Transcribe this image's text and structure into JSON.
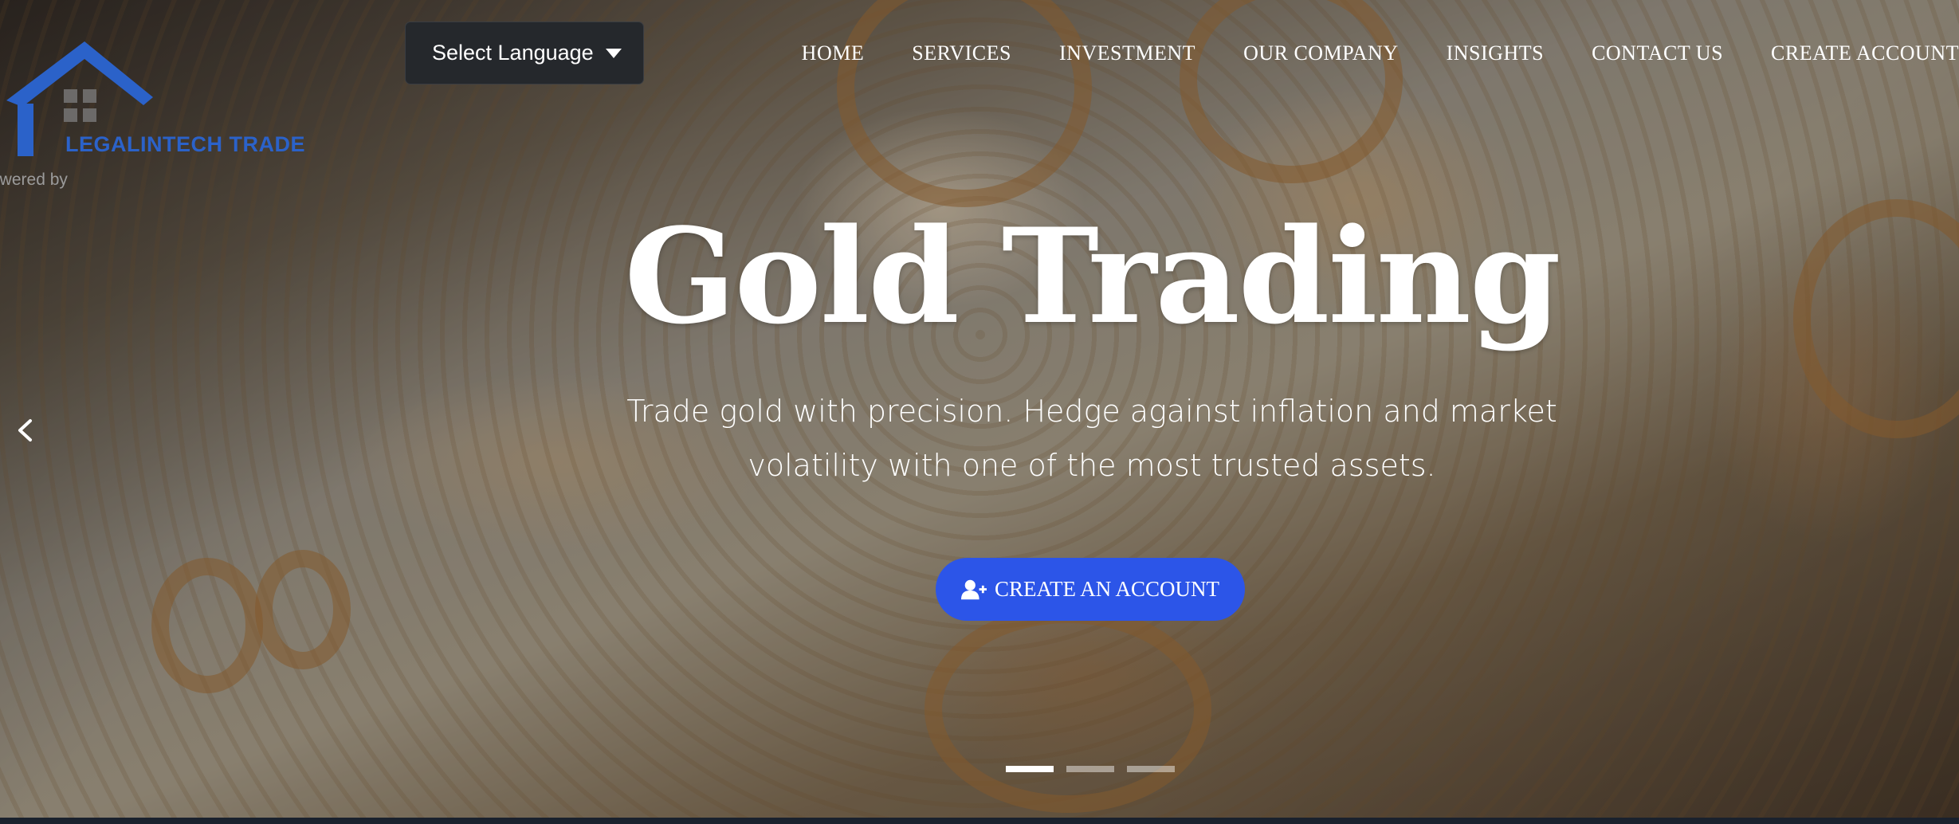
{
  "brand": {
    "name": "LEGALINTECH TRADE",
    "powered_by": "owered by",
    "color": "#2b62c9"
  },
  "language_select": {
    "selected": "Select Language"
  },
  "nav": {
    "items": [
      {
        "label": "HOME"
      },
      {
        "label": "SERVICES"
      },
      {
        "label": "INVESTMENT"
      },
      {
        "label": "OUR COMPANY"
      },
      {
        "label": "INSIGHTS"
      },
      {
        "label": "CONTACT US"
      },
      {
        "label": "CREATE ACCOUNT"
      }
    ]
  },
  "hero": {
    "title": "Gold Trading",
    "subtitle": "Trade gold with precision. Hedge against inflation and market volatility with one of the most trusted assets.",
    "cta_label": "CREATE AN ACCOUNT",
    "cta_icon": "user-plus-icon",
    "cta_color": "#2c55e8",
    "prev_icon": "chevron-left-icon",
    "slides": {
      "count": 3,
      "active": 1
    }
  }
}
